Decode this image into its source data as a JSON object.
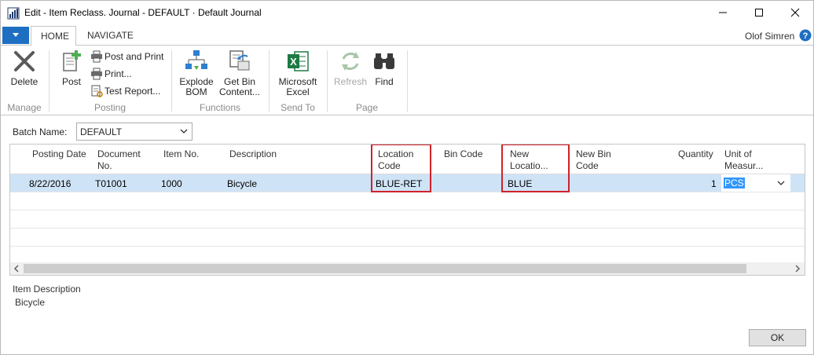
{
  "window": {
    "title": "Edit - Item Reclass. Journal - DEFAULT · Default Journal"
  },
  "tabs": [
    {
      "label": "HOME"
    },
    {
      "label": "NAVIGATE"
    }
  ],
  "user": {
    "name": "Olof Simren"
  },
  "ribbon": {
    "manage": {
      "group_label": "Manage",
      "delete_label": "Delete"
    },
    "posting": {
      "group_label": "Posting",
      "post_label": "Post",
      "post_and_print_label": "Post and Print",
      "print_label": "Print...",
      "test_report_label": "Test Report..."
    },
    "functions": {
      "group_label": "Functions",
      "explode_bom_line1": "Explode",
      "explode_bom_line2": "BOM",
      "get_bin_line1": "Get Bin",
      "get_bin_line2": "Content..."
    },
    "send_to": {
      "group_label": "Send To",
      "excel_line1": "Microsoft",
      "excel_line2": "Excel"
    },
    "page": {
      "group_label": "Page",
      "refresh_label": "Refresh",
      "find_label": "Find"
    }
  },
  "batch": {
    "label": "Batch Name:",
    "value": "DEFAULT"
  },
  "grid": {
    "columns": [
      {
        "line1": "Posting Date",
        "line2": ""
      },
      {
        "line1": "Document",
        "line2": "No."
      },
      {
        "line1": "Item No.",
        "line2": ""
      },
      {
        "line1": "Description",
        "line2": ""
      },
      {
        "line1": "Location",
        "line2": "Code"
      },
      {
        "line1": "Bin Code",
        "line2": ""
      },
      {
        "line1": "New",
        "line2": "Locatio..."
      },
      {
        "line1": "New Bin",
        "line2": "Code"
      },
      {
        "line1": "Quantity",
        "line2": ""
      },
      {
        "line1": "Unit of",
        "line2": "Measur..."
      }
    ],
    "rows": [
      {
        "posting_date": "8/22/2016",
        "document_no": "T01001",
        "item_no": "1000",
        "description": "Bicycle",
        "location_code": "BLUE-RET",
        "bin_code": "",
        "new_location": "BLUE",
        "new_bin_code": "",
        "quantity": "1",
        "unit_of_measure": "PCS"
      }
    ]
  },
  "factbox": {
    "label": "Item Description",
    "value": "Bicycle"
  },
  "ok_label": "OK",
  "colors": {
    "accent": "#1e6fc2",
    "selection": "#cfe3f6",
    "highlight_box": "#d0222b"
  }
}
